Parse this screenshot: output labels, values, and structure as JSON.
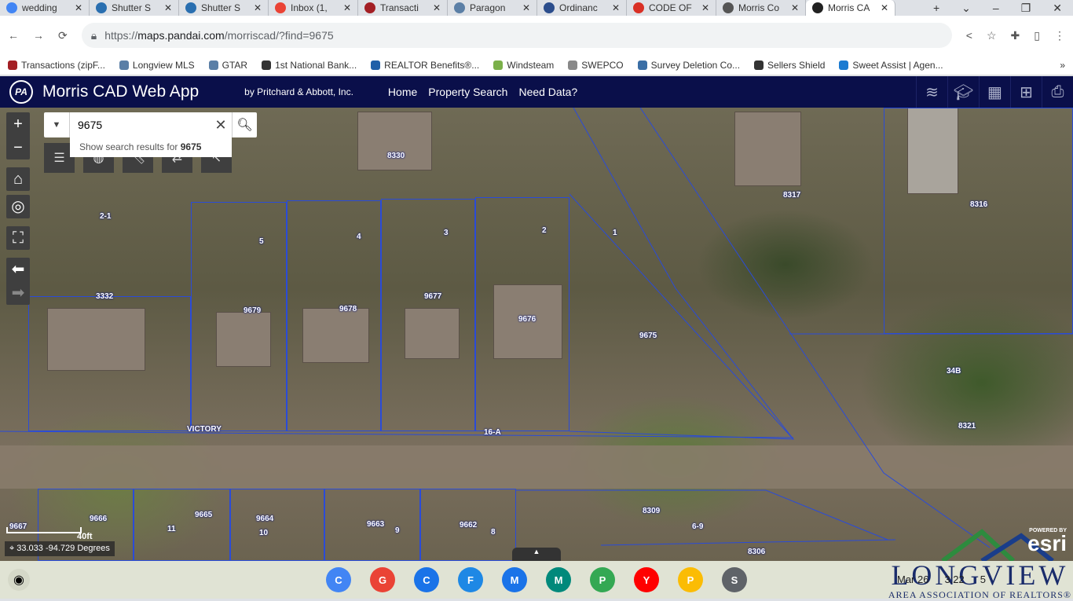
{
  "browser": {
    "tabs": [
      {
        "title": "wedding",
        "color": "#4285f4"
      },
      {
        "title": "Shutter S",
        "color": "#2a6fb0"
      },
      {
        "title": "Shutter S",
        "color": "#2a6fb0"
      },
      {
        "title": "Inbox (1,",
        "color": "#ea4335"
      },
      {
        "title": "Transacti",
        "color": "#a31f24"
      },
      {
        "title": "Paragon",
        "color": "#5b7fa6"
      },
      {
        "title": "Ordinanc",
        "color": "#2b4d8c"
      },
      {
        "title": "CODE OF",
        "color": "#d93025"
      },
      {
        "title": "Morris Co",
        "color": "#555555"
      },
      {
        "title": "Morris CA",
        "color": "#222222",
        "active": true
      }
    ],
    "url_prefix": "https://",
    "url_host": "maps.pandai.com",
    "url_path": "/morriscad/?find=9675",
    "bookmarks": [
      {
        "label": "Transactions (zipF...",
        "color": "#a31f24"
      },
      {
        "label": "Longview MLS",
        "color": "#5b7fa6"
      },
      {
        "label": "GTAR",
        "color": "#5b7fa6"
      },
      {
        "label": "1st National Bank...",
        "color": "#333333"
      },
      {
        "label": "REALTOR Benefits®...",
        "color": "#1f5fa8"
      },
      {
        "label": "Windsteam",
        "color": "#7bb04a"
      },
      {
        "label": "SWEPCO",
        "color": "#888888"
      },
      {
        "label": "Survey Deletion Co...",
        "color": "#3a6ea5"
      },
      {
        "label": "Sellers Shield",
        "color": "#333333"
      },
      {
        "label": "Sweet Assist | Agen...",
        "color": "#1b7bd1"
      }
    ],
    "more_bookmarks": "»"
  },
  "app": {
    "logo": "PA",
    "title": "Morris CAD Web App",
    "byline": "by Pritchard & Abbott, Inc.",
    "nav": [
      "Home",
      "Property Search",
      "Need Data?"
    ],
    "header_icons": [
      "layers-icon",
      "graduation-cap-icon",
      "grid-icon",
      "add-map-icon",
      "print-icon"
    ]
  },
  "search": {
    "value": "9675",
    "suggestion_prefix": "Show search results for ",
    "suggestion_term": "9675"
  },
  "map": {
    "parcel_labels": [
      "8330",
      "8317",
      "8316",
      "2-1",
      "5",
      "4",
      "3",
      "2",
      "1",
      "3332",
      "9679",
      "9678",
      "9677",
      "9676",
      "9675",
      "34B",
      "8321",
      "VICTORY",
      "16-A",
      "9666",
      "9665",
      "9664",
      "9663",
      "9662",
      "11",
      "10",
      "9",
      "8",
      "8309",
      "6-9",
      "8306",
      "9667"
    ],
    "scale": "40ft",
    "coordinates": "33.033 -94.729 Degrees",
    "powered_by": "POWERED BY",
    "esri": "esri"
  },
  "shelf": {
    "apps": [
      "Chrome",
      "Gmail",
      "Calendar",
      "Files",
      "Messages",
      "Meet",
      "Play Store",
      "YouTube",
      "Photos",
      "Settings"
    ],
    "app_colors": [
      "#4285f4",
      "#ea4335",
      "#1a73e8",
      "#1e88e5",
      "#1a73e8",
      "#00897b",
      "#34a853",
      "#ff0000",
      "#fbbc04",
      "#5f6368"
    ],
    "date": "Mar 26",
    "time": "3:22",
    "notifications": "5"
  },
  "watermark": {
    "line1": "LONGVIEW",
    "line2": "AREA ASSOCIATION OF REALTORS®"
  }
}
